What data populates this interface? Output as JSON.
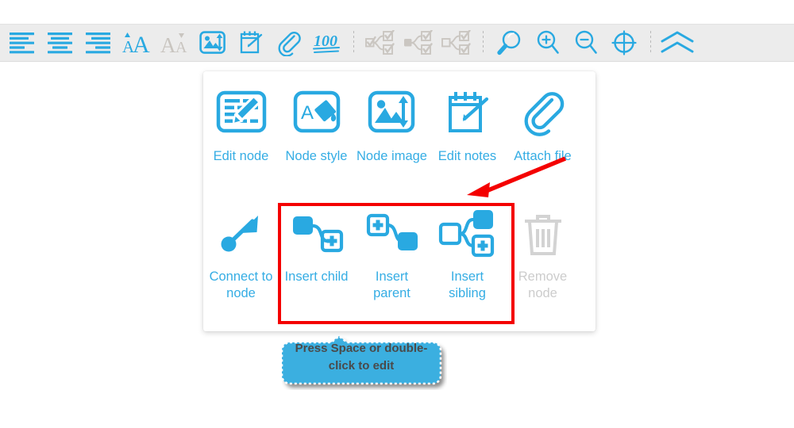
{
  "colors": {
    "accent_blue": "#35ADE4",
    "icon_blue": "#29A9E1",
    "disabled_grey": "#cccccc",
    "toolbar_bg": "#ececec",
    "highlight_red": "#f40000",
    "tooltip_fill": "#3BAFE0",
    "tooltip_text": "#4a4a4a"
  },
  "toolbar": {
    "groups": [
      {
        "buttons": [
          {
            "name": "align-left-icon",
            "title": "Align left"
          },
          {
            "name": "align-center-icon",
            "title": "Align center"
          },
          {
            "name": "align-right-icon",
            "title": "Align right"
          },
          {
            "name": "increase-font-size-icon",
            "title": "Increase font size"
          },
          {
            "name": "decrease-font-size-icon",
            "title": "Decrease font size",
            "disabled": true
          },
          {
            "name": "node-image-icon",
            "title": "Node image"
          },
          {
            "name": "edit-notes-icon",
            "title": "Edit notes"
          },
          {
            "name": "attach-file-icon",
            "title": "Attach file"
          },
          {
            "name": "hundred-points-icon",
            "title": "Progress 100"
          }
        ]
      },
      {
        "buttons": [
          {
            "name": "check-all-branch-icon",
            "title": "Check all in branch",
            "disabled": true
          },
          {
            "name": "uncheck-branch-icon",
            "title": "Uncheck branch",
            "disabled": true
          },
          {
            "name": "toggle-checkbox-branch-icon",
            "title": "Toggle checkbox branch",
            "disabled": true
          }
        ]
      },
      {
        "buttons": [
          {
            "name": "search-icon",
            "title": "Search"
          },
          {
            "name": "zoom-in-icon",
            "title": "Zoom in"
          },
          {
            "name": "zoom-out-icon",
            "title": "Zoom out"
          },
          {
            "name": "center-view-icon",
            "title": "Center view"
          }
        ]
      },
      {
        "buttons": [
          {
            "name": "collapse-toolbar-icon",
            "title": "Collapse toolbar"
          }
        ]
      }
    ]
  },
  "node_panel": {
    "rows": [
      {
        "items": [
          {
            "icon": "edit-node-icon",
            "label": "Edit node",
            "disabled": false
          },
          {
            "icon": "node-style-icon",
            "label": "Node style",
            "disabled": false
          },
          {
            "icon": "node-image-icon",
            "label": "Node image",
            "disabled": false
          },
          {
            "icon": "edit-notes-icon",
            "label": "Edit notes",
            "disabled": false
          },
          {
            "icon": "attach-file-icon",
            "label": "Attach file",
            "disabled": false
          }
        ]
      },
      {
        "items": [
          {
            "icon": "connect-to-node-icon",
            "label": "Connect to node",
            "disabled": false
          },
          {
            "icon": "insert-child-icon",
            "label": "Insert child",
            "disabled": false
          },
          {
            "icon": "insert-parent-icon",
            "label": "Insert parent",
            "disabled": false
          },
          {
            "icon": "insert-sibling-icon",
            "label": "Insert sibling",
            "disabled": false
          },
          {
            "icon": "remove-node-icon",
            "label": "Remove node",
            "disabled": true
          }
        ]
      }
    ]
  },
  "annotations": {
    "highlight_rectangle": "insert-node-group",
    "arrow": "points-to-insert-node-group"
  },
  "tooltip": {
    "text": "Press Space or double-click to edit"
  }
}
